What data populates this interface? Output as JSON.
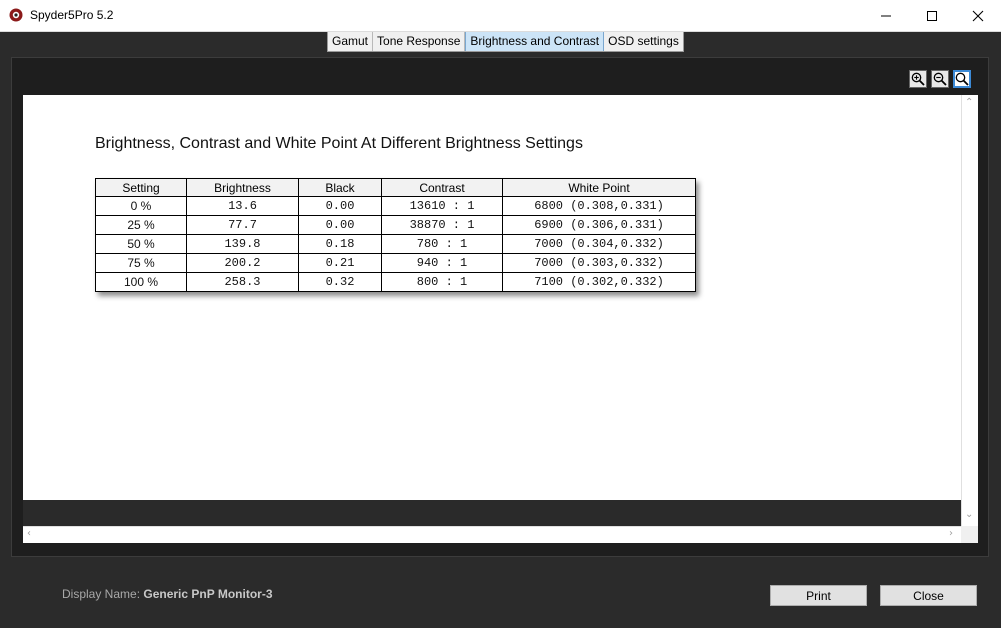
{
  "window": {
    "title": "Spyder5Pro 5.2",
    "icon": "spyder-app-icon"
  },
  "tabs": [
    {
      "label": "Gamut",
      "active": false
    },
    {
      "label": "Tone Response",
      "active": false
    },
    {
      "label": "Brightness and Contrast",
      "active": true
    },
    {
      "label": "OSD settings",
      "active": false
    }
  ],
  "toolbar": {
    "zoom_in_icon": "zoom-in-icon",
    "zoom_out_icon": "zoom-out-icon",
    "zoom_fit_icon": "zoom-fit-icon"
  },
  "report": {
    "title": "Brightness, Contrast and White Point At Different Brightness Settings",
    "columns": [
      "Setting",
      "Brightness",
      "Black",
      "Contrast",
      "White Point"
    ],
    "rows": [
      [
        "0 %",
        "13.6",
        "0.00",
        "13610 : 1",
        "6800 (0.308,0.331)"
      ],
      [
        "25 %",
        "77.7",
        "0.00",
        "38870 : 1",
        "6900 (0.306,0.331)"
      ],
      [
        "50 %",
        "139.8",
        "0.18",
        "780 : 1",
        "7000 (0.304,0.332)"
      ],
      [
        "75 %",
        "200.2",
        "0.21",
        "940 : 1",
        "7000 (0.303,0.332)"
      ],
      [
        "100 %",
        "258.3",
        "0.32",
        "800 : 1",
        "7100 (0.302,0.332)"
      ]
    ]
  },
  "footer": {
    "display_name_label": "Display Name:",
    "display_name_value": "Generic PnP Monitor-3",
    "print_label": "Print",
    "close_label": "Close"
  },
  "colors": {
    "background": "#2b2b2b",
    "active_tab": "#cce4f7",
    "accent": "#3c8ad6"
  }
}
